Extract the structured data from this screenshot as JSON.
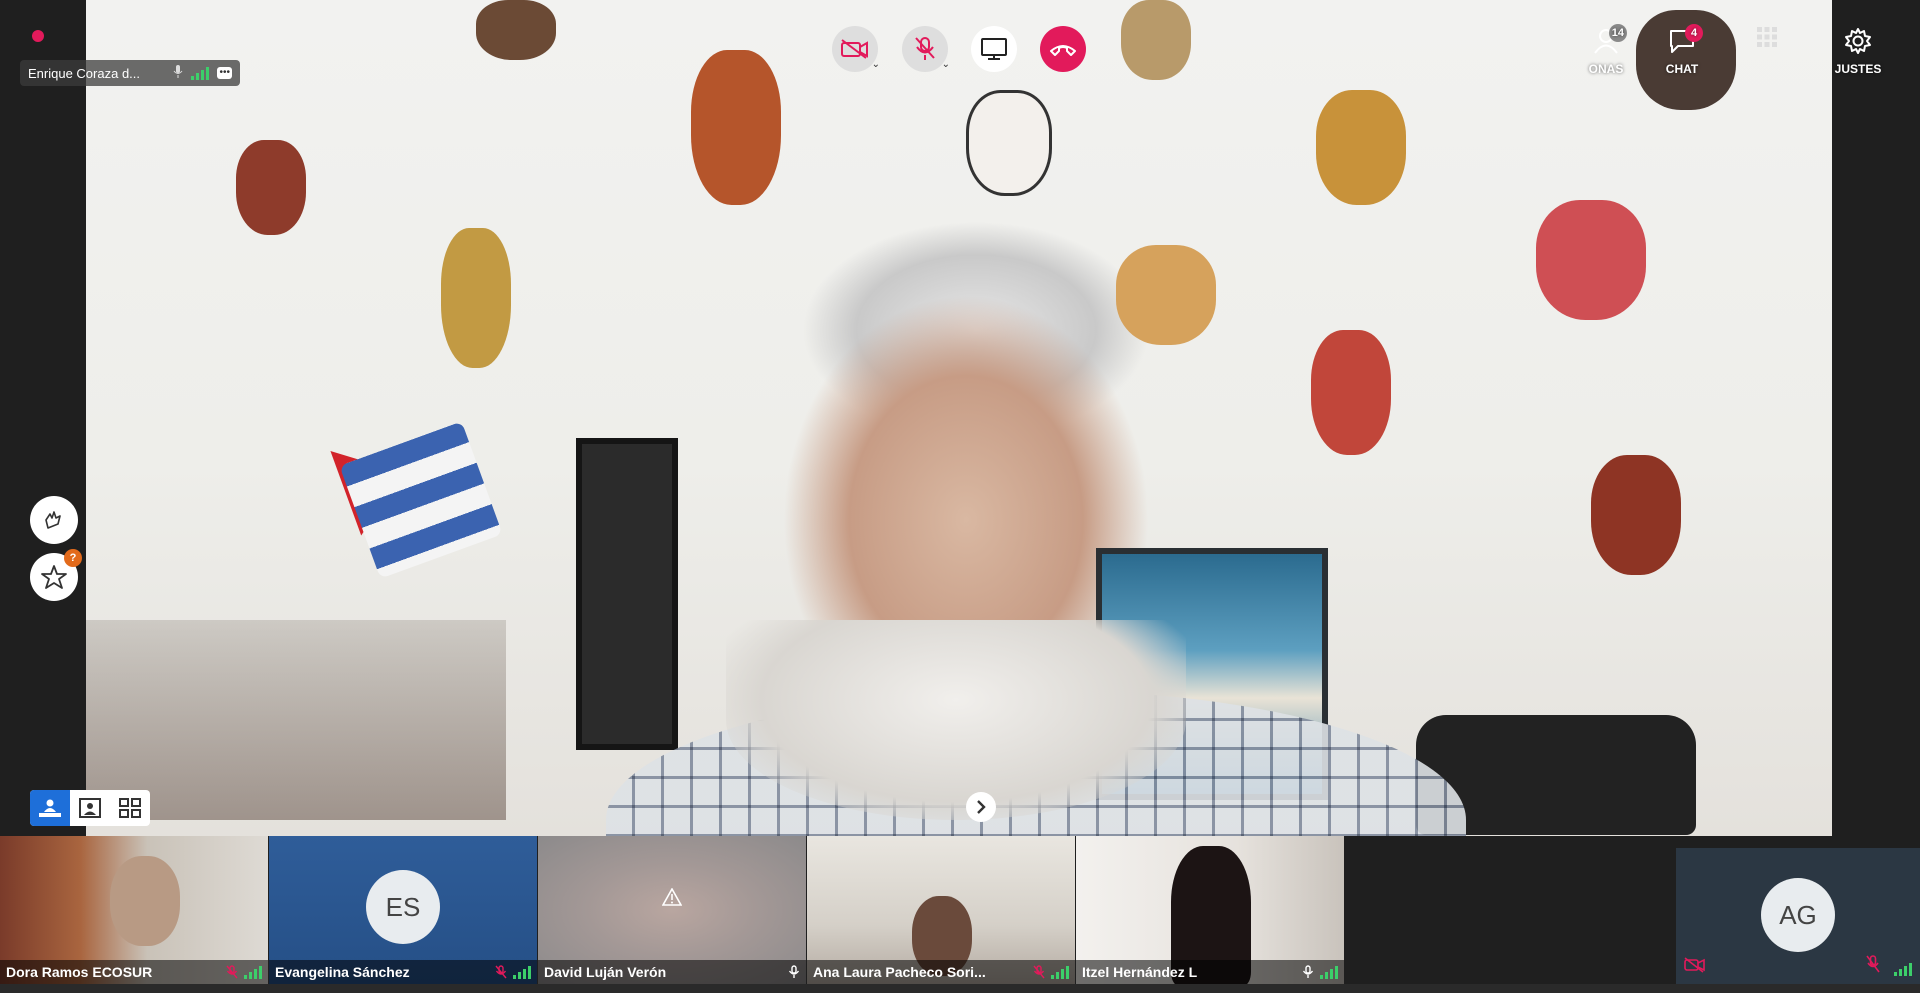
{
  "top_left": {
    "speaker_name": "Enrique Coraza d..."
  },
  "controls": {
    "camera_icon": "camera-off-icon",
    "mic_icon": "mic-off-icon",
    "share_icon": "screen-share-icon",
    "hangup_icon": "hangup-icon"
  },
  "right_tools": {
    "people": {
      "label": "PERSONAS",
      "visible_label": "ONAS",
      "count": "14"
    },
    "chat": {
      "label": "CHAT",
      "count": "4"
    },
    "grid": {
      "label": ""
    },
    "settings": {
      "label": "AJUSTES",
      "visible_label": "JUSTES"
    }
  },
  "side_buttons": {
    "reactions_icon": "clap-icon",
    "favorite_icon": "star-icon",
    "favorite_badge": "?"
  },
  "thumbnails": [
    {
      "name": "Dora Ramos ECOSUR",
      "mic": "muted"
    },
    {
      "name": "Evangelina Sánchez",
      "initials": "ES",
      "mic": "muted"
    },
    {
      "name": "David Luján Verón",
      "mic": "on"
    },
    {
      "name": "Ana Laura Pacheco Sori...",
      "mic": "muted"
    },
    {
      "name": "Itzel Hernández L",
      "mic": "on"
    }
  ],
  "self_view": {
    "initials": "AG"
  },
  "colors": {
    "accent": "#e21a5b",
    "active_layout": "#1e6fd9",
    "signal": "#3ccf6a"
  }
}
